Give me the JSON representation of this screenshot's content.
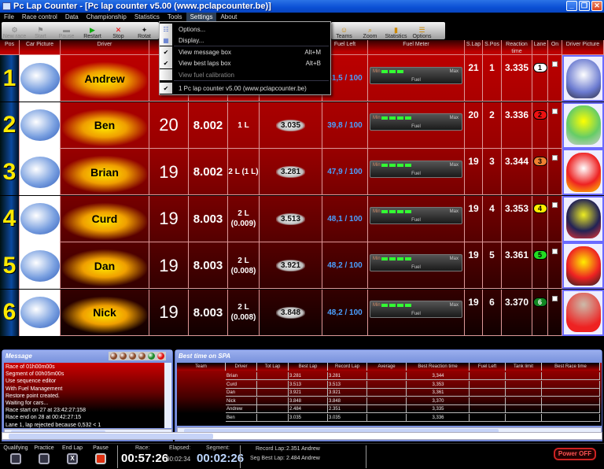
{
  "window": {
    "title": "Pc Lap Counter - [Pc lap counter v5.00 (www.pclapcounter.be)]",
    "controls": [
      "_",
      "❐",
      "✕"
    ]
  },
  "menubar": [
    "File",
    "Race control",
    "Data",
    "Championship",
    "Statistics",
    "Tools",
    "Settings",
    "About"
  ],
  "toolbar": [
    {
      "label": "New race",
      "icon": "new-race-icon",
      "glyph": "⚙",
      "disabled": true
    },
    {
      "label": "Start",
      "icon": "flag-icon",
      "glyph": "⚑",
      "disabled": true
    },
    {
      "label": "Pause",
      "icon": "pause-icon",
      "glyph": "▬",
      "disabled": true
    },
    {
      "label": "Restart",
      "icon": "play-icon",
      "glyph": "▶",
      "disabled": false
    },
    {
      "label": "Stop",
      "icon": "stop-x-icon",
      "glyph": "✕",
      "disabled": false
    },
    {
      "label": "Rotat",
      "icon": "rotate-icon",
      "glyph": "✦",
      "disabled": false
    }
  ],
  "toolbar2": [
    {
      "label": "Teams",
      "icon": "teams-icon",
      "glyph": "☺"
    },
    {
      "label": "Zoom",
      "icon": "zoom-icon",
      "glyph": "⌕"
    },
    {
      "label": "Statistics",
      "icon": "statistics-icon",
      "glyph": "▮"
    },
    {
      "label": "Options",
      "icon": "options-icon",
      "glyph": "☰"
    }
  ],
  "settings_menu": [
    {
      "label": "Options...",
      "icon": "options-icon",
      "checked": false,
      "shortcut": "",
      "disabled": false
    },
    {
      "label": "Display...",
      "icon": "display-icon",
      "checked": false,
      "shortcut": "",
      "disabled": false
    },
    {
      "label": "View message box",
      "checked": true,
      "shortcut": "Alt+M",
      "disabled": false
    },
    {
      "label": "View best laps box",
      "checked": true,
      "shortcut": "Alt+B",
      "disabled": false
    },
    {
      "label": "View fuel calibration",
      "checked": false,
      "shortcut": "",
      "disabled": true
    },
    {
      "label": "1 Pc lap counter v5.00 (www.pclapcounter.be)",
      "checked": true,
      "shortcut": "",
      "disabled": false
    }
  ],
  "grid_headers": {
    "pos": "Pos",
    "car_picture": "Car Picture",
    "driver": "Driver",
    "fuel_left": "Fuel Left",
    "fuel_meter": "Fuel Meter",
    "s_lap": "S.Lap",
    "s_pos": "S.Pos",
    "reaction": "Reaction time",
    "lane": "Lane",
    "on": "On",
    "driver_picture": "Driver Picture"
  },
  "fuel_meter_labels": {
    "min": "Min",
    "max": "Max",
    "fuel": "Fuel"
  },
  "drivers": [
    {
      "pos": "1",
      "name": "Andrew",
      "laps": "",
      "laptime": "",
      "gap": "",
      "best": "",
      "fuel_left": "41,5 / 100",
      "fuel_bars": 3,
      "s_lap": "21",
      "s_pos": "1",
      "reaction": "3.335",
      "lane": "1",
      "lane_color": "#ffffff"
    },
    {
      "pos": "2",
      "name": "Ben",
      "laps": "20",
      "laptime": "8.002",
      "gap": "1 L",
      "best": "3.035",
      "fuel_left": "39,8 / 100",
      "fuel_bars": 4,
      "s_lap": "20",
      "s_pos": "2",
      "reaction": "3.336",
      "lane": "2",
      "lane_color": "#ee1111"
    },
    {
      "pos": "3",
      "name": "Brian",
      "laps": "19",
      "laptime": "8.002",
      "gap": "2 L (1 L)",
      "best": "3.281",
      "fuel_left": "47,9 / 100",
      "fuel_bars": 4,
      "s_lap": "19",
      "s_pos": "3",
      "reaction": "3.344",
      "lane": "3",
      "lane_color": "#f08030"
    },
    {
      "pos": "4",
      "name": "Curd",
      "laps": "19",
      "laptime": "8.003",
      "gap": "2 L (0.009)",
      "best": "3.513",
      "fuel_left": "48,1 / 100",
      "fuel_bars": 4,
      "s_lap": "19",
      "s_pos": "4",
      "reaction": "3.353",
      "lane": "4",
      "lane_color": "#ffee00"
    },
    {
      "pos": "5",
      "name": "Dan",
      "laps": "19",
      "laptime": "8.003",
      "gap": "2 L (0.008)",
      "best": "3.921",
      "fuel_left": "48,2 / 100",
      "fuel_bars": 4,
      "s_lap": "19",
      "s_pos": "5",
      "reaction": "3.361",
      "lane": "5",
      "lane_color": "#22dd22"
    },
    {
      "pos": "6",
      "name": "Nick",
      "laps": "19",
      "laptime": "8.003",
      "gap": "2 L (0.008)",
      "best": "3.848",
      "fuel_left": "48,2 / 100",
      "fuel_bars": 4,
      "s_lap": "19",
      "s_pos": "6",
      "reaction": "3.370",
      "lane": "6",
      "lane_color": "#118822"
    }
  ],
  "message_box": {
    "title": "Message",
    "led_colors": [
      "#8a4a2a",
      "#8a4a2a",
      "#8a4a2a",
      "#8a4a2a",
      "#1a8a2a",
      "#e01010"
    ],
    "lines": [
      "Race of 01h00m00s",
      "Segment of 00h05m00s",
      "Use sequence editor",
      "With Fuel Management",
      "Restore point created.",
      "Waiting for cars...",
      "Race start on 27 at 23:42:27:158",
      "Race end on 28 at 00:42:27:15",
      "Lane 1, lap rejected because 0,532 < 1"
    ]
  },
  "best_box": {
    "title": "Best time on SPA",
    "columns": [
      "Team",
      "Driver",
      "Tot Lap",
      "Best Lap",
      "Record Lap",
      "Average",
      "Best Reaction time",
      "Fuel Left",
      "Tank limit",
      "Best Race time"
    ],
    "rows": [
      [
        "",
        "Brian",
        "",
        "3.281",
        "3.281",
        "",
        "3,344",
        "",
        "",
        ""
      ],
      [
        "",
        "Curd",
        "",
        "3.513",
        "3.513",
        "",
        "3,353",
        "",
        "",
        ""
      ],
      [
        "",
        "Dan",
        "",
        "3.921",
        "3.921",
        "",
        "3,361",
        "",
        "",
        ""
      ],
      [
        "",
        "Nick",
        "",
        "3.848",
        "3.848",
        "",
        "3,370",
        "",
        "",
        ""
      ],
      [
        "",
        "Andrew",
        "",
        "2.484",
        "2.351",
        "",
        "3,335",
        "",
        "",
        ""
      ],
      [
        "",
        "Ben",
        "",
        "3.035",
        "3.035",
        "",
        "3,336",
        "",
        "",
        ""
      ]
    ]
  },
  "status": {
    "buttons": [
      {
        "label": "Qualifying",
        "glyph": ""
      },
      {
        "label": "Practice",
        "glyph": ""
      },
      {
        "label": "End Lap",
        "glyph": "X"
      },
      {
        "label": "Pause",
        "glyph": ""
      }
    ],
    "race_label": "Race:",
    "race_value": "00:57:26",
    "elapsed_label": "Elapsed:",
    "elapsed_value": "00:02:34",
    "segment_label": "Segment:",
    "segment_value": "00:02:26",
    "record_lap_label": "Record Lap:",
    "record_lap_value": "2.351 Andrew",
    "seg_best_label": "Seg Best Lap:",
    "seg_best_value": "2.484 Andrew",
    "power_label": "Power OFF"
  }
}
